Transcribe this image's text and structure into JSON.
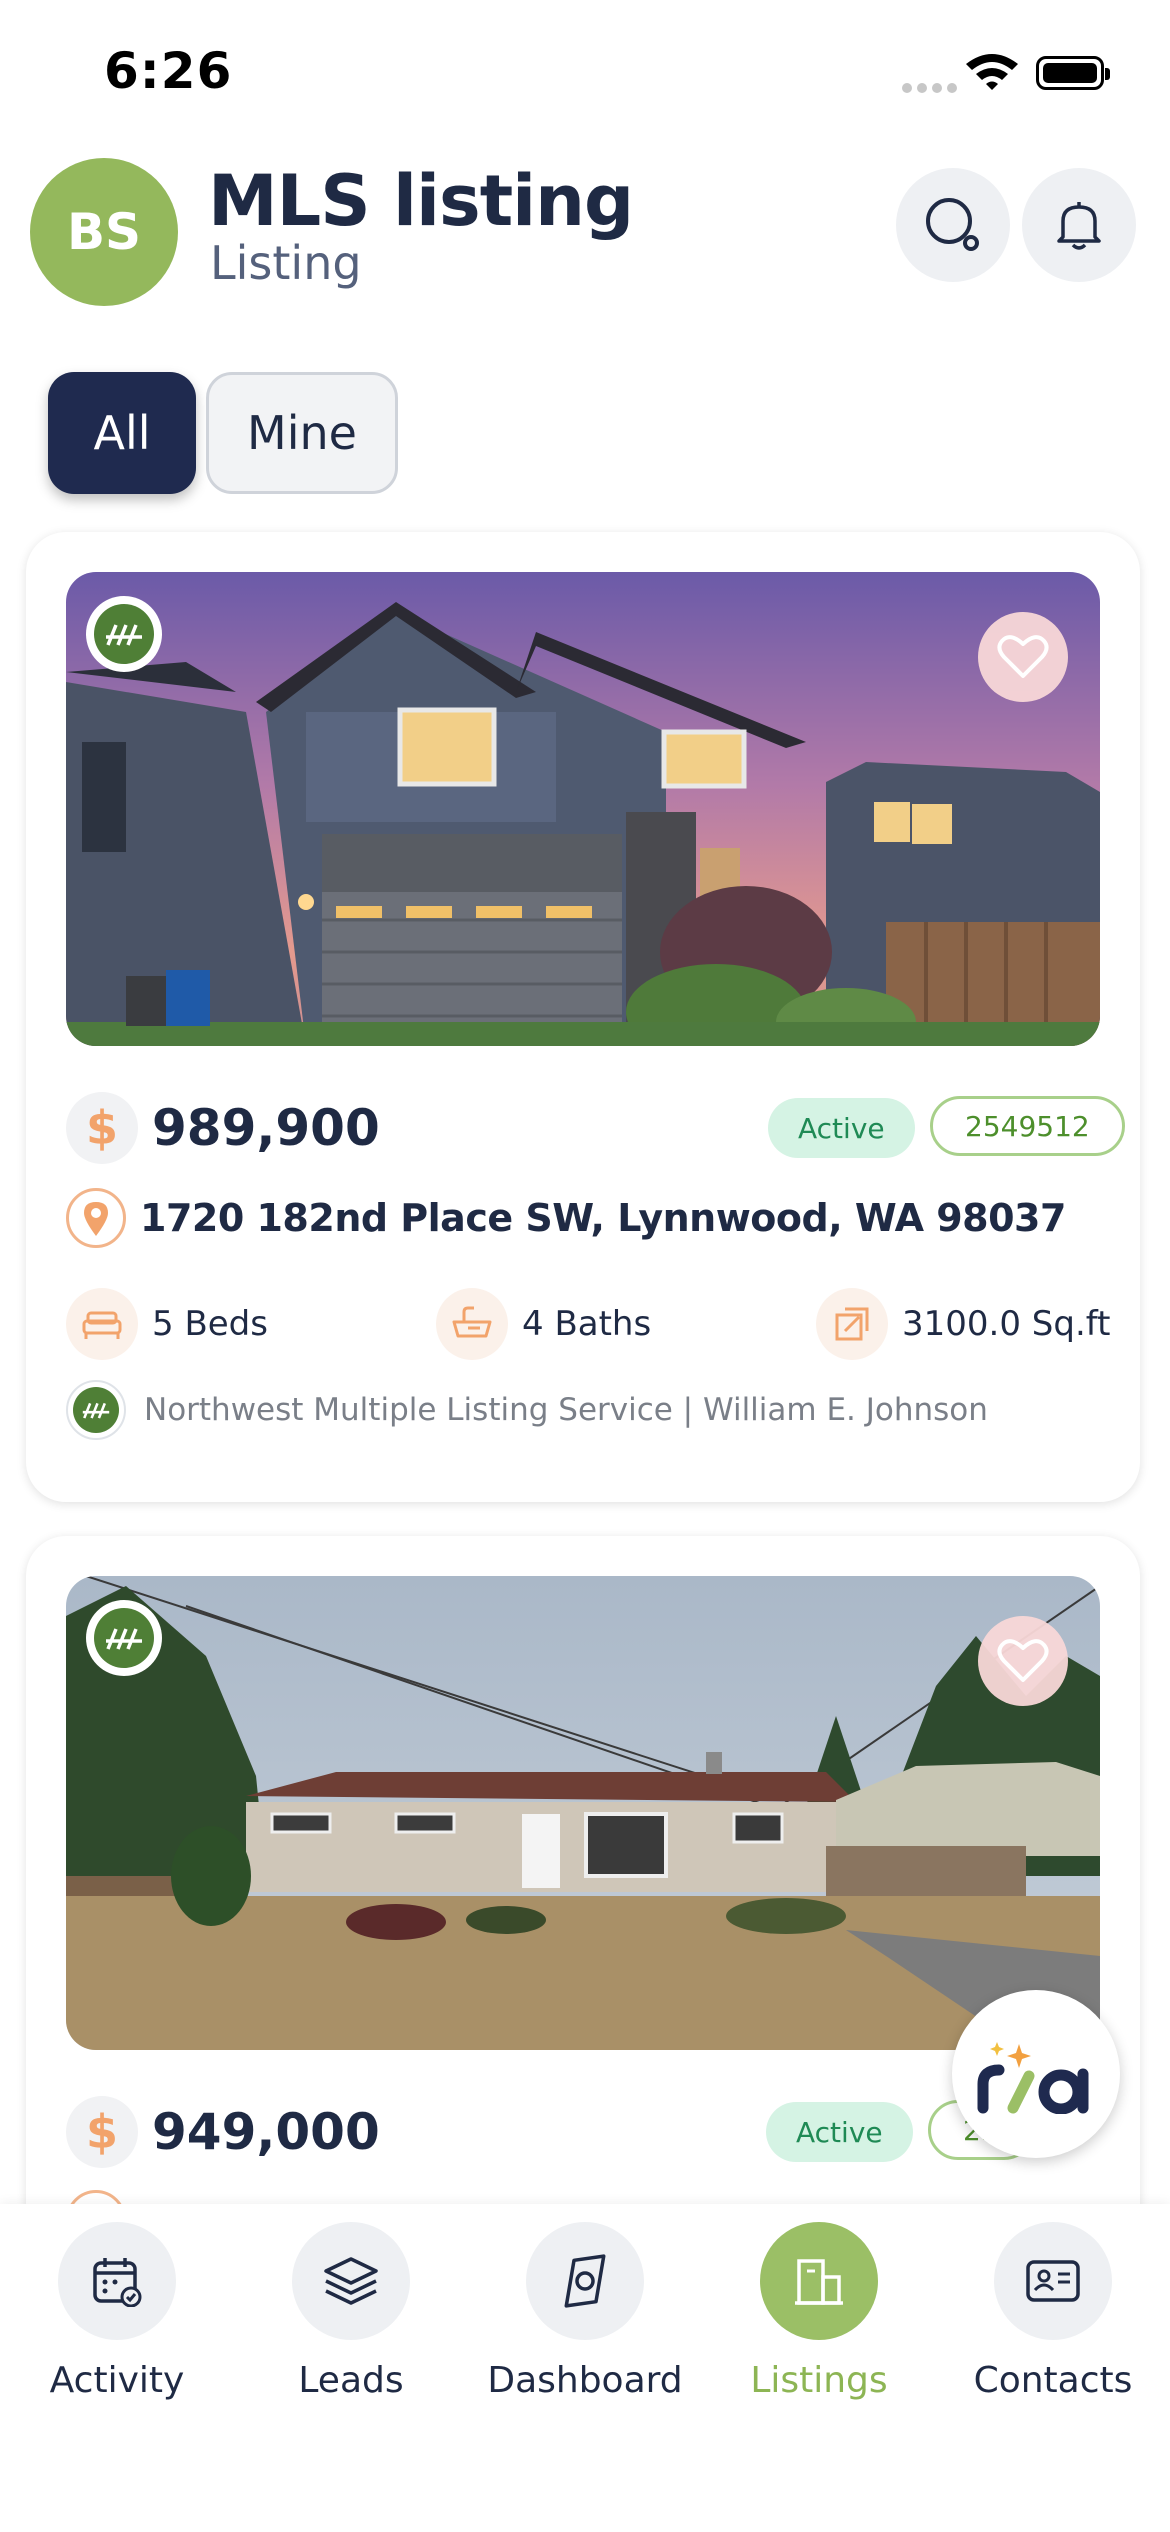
{
  "status_bar": {
    "time": "6:26"
  },
  "header": {
    "avatar_initials": "BS",
    "title": "MLS listing",
    "subtitle": "Listing"
  },
  "filter_tabs": [
    {
      "label": "All",
      "selected": true
    },
    {
      "label": "Mine",
      "selected": false
    }
  ],
  "listings": [
    {
      "price_icon": "$",
      "price": "989,900",
      "status": "Active",
      "mls_id": "2549512",
      "address": "1720 182nd Place SW, Lynnwood, WA 98037",
      "beds": "5 Beds",
      "baths": "4 Baths",
      "area": "3100.0 Sq.ft",
      "source": "Northwest Multiple Listing Service | William E. Johnson"
    },
    {
      "price_icon": "$",
      "price": "949,000",
      "status": "Active",
      "mls_id_partial": "25"
    }
  ],
  "bottom_nav": [
    {
      "label": "Activity",
      "icon": "calendar-check-icon",
      "active": false
    },
    {
      "label": "Leads",
      "icon": "layers-icon",
      "active": false
    },
    {
      "label": "Dashboard",
      "icon": "compass-icon",
      "active": false
    },
    {
      "label": "Listings",
      "icon": "building-icon",
      "active": true
    },
    {
      "label": "Contacts",
      "icon": "contact-card-icon",
      "active": false
    }
  ],
  "colors": {
    "navy": "#1f2a4f",
    "green_accent": "#94b85c",
    "orange_icon": "#f2a36b"
  }
}
